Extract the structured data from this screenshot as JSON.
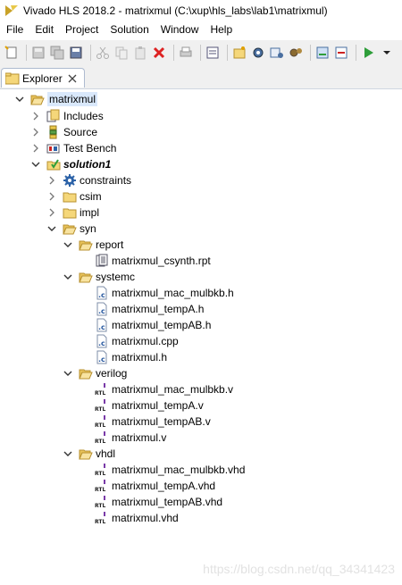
{
  "window": {
    "title": "Vivado HLS 2018.2 - matrixmul (C:\\xup\\hls_labs\\lab1\\matrixmul)"
  },
  "menu": [
    "File",
    "Edit",
    "Project",
    "Solution",
    "Window",
    "Help"
  ],
  "explorer": {
    "tab_label": "Explorer",
    "project": "matrixmul",
    "includes": "Includes",
    "source": "Source",
    "testbench": "Test Bench",
    "solution": "solution1",
    "constraints": "constraints",
    "csim": "csim",
    "impl": "impl",
    "syn": "syn",
    "report": "report",
    "report_files": [
      "matrixmul_csynth.rpt"
    ],
    "systemc": "systemc",
    "systemc_files": [
      "matrixmul_mac_mulbkb.h",
      "matrixmul_tempA.h",
      "matrixmul_tempAB.h",
      "matrixmul.cpp",
      "matrixmul.h"
    ],
    "verilog": "verilog",
    "verilog_files": [
      "matrixmul_mac_mulbkb.v",
      "matrixmul_tempA.v",
      "matrixmul_tempAB.v",
      "matrixmul.v"
    ],
    "vhdl": "vhdl",
    "vhdl_files": [
      "matrixmul_mac_mulbkb.vhd",
      "matrixmul_tempA.vhd",
      "matrixmul_tempAB.vhd",
      "matrixmul.vhd"
    ]
  },
  "watermark": "https://blog.csdn.net/qq_34341423",
  "colors": {
    "selection": "#d9e8fb",
    "folder": "#e8c56a",
    "run": "#2e9e3a",
    "delete": "#d22"
  }
}
